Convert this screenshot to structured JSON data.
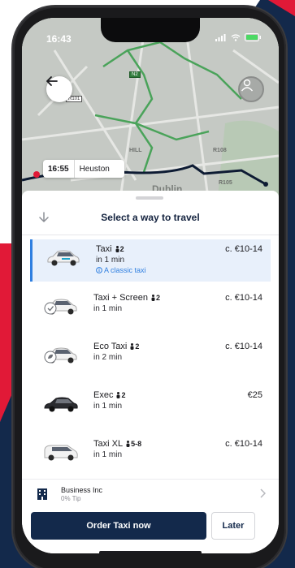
{
  "status_bar": {
    "time": "16:43"
  },
  "map": {
    "eta_time": "16:55",
    "eta_place": "Heuston",
    "labels": [
      "R101",
      "R108",
      "R105",
      "HILL",
      "Dublin"
    ],
    "sign_r": "R101",
    "sign_n": "N2"
  },
  "sheet": {
    "title": "Select a way to travel",
    "options": [
      {
        "name": "Taxi",
        "pax": "2",
        "time": "in 1 min",
        "desc": "A classic taxi",
        "price": "c. €10-14",
        "selected": true
      },
      {
        "name": "Taxi + Screen",
        "pax": "2",
        "time": "in 1 min",
        "desc": "",
        "price": "c. €10-14",
        "selected": false
      },
      {
        "name": "Eco Taxi",
        "pax": "2",
        "time": "in 2 min",
        "desc": "",
        "price": "c. €10-14",
        "selected": false
      },
      {
        "name": "Exec",
        "pax": "2",
        "time": "in 1 min",
        "desc": "",
        "price": "€25",
        "selected": false
      },
      {
        "name": "Taxi XL",
        "pax": "5-8",
        "time": "in 1 min",
        "desc": "",
        "price": "c. €10-14",
        "selected": false
      }
    ]
  },
  "payment": {
    "name": "Business Inc",
    "tip": "0% Tip"
  },
  "actions": {
    "order_label": "Order Taxi now",
    "later_label": "Later"
  },
  "colors": {
    "navy": "#13294b",
    "red": "#e11937",
    "accent": "#2f7fe0",
    "selected_bg": "#e8f0fb"
  }
}
